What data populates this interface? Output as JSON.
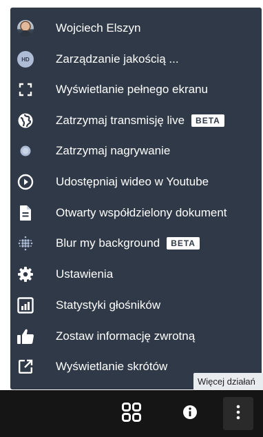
{
  "menu": {
    "items": [
      {
        "label": "Wojciech Elszyn",
        "icon": "avatar"
      },
      {
        "label": "Zarządzanie jakością ...",
        "icon": "hd-icon",
        "icon_text": "HD"
      },
      {
        "label": "Wyświetlanie pełnego ekranu",
        "icon": "fullscreen-icon"
      },
      {
        "label": "Zatrzymaj transmisję live",
        "icon": "live-stream-icon",
        "badge": "BETA"
      },
      {
        "label": "Zatrzymaj nagrywanie",
        "icon": "recording-icon"
      },
      {
        "label": "Udostępniaj wideo w Youtube",
        "icon": "play-circle-icon"
      },
      {
        "label": "Otwarty współdzielony dokument",
        "icon": "document-icon"
      },
      {
        "label": "Blur my background",
        "icon": "blur-icon",
        "badge": "BETA"
      },
      {
        "label": "Ustawienia",
        "icon": "gear-icon"
      },
      {
        "label": "Statystyki głośników",
        "icon": "bar-chart-icon"
      },
      {
        "label": "Zostaw informację zwrotną",
        "icon": "thumbs-up-icon"
      },
      {
        "label": "Wyświetlanie skrótów",
        "icon": "external-link-icon"
      }
    ]
  },
  "tooltip": {
    "text": "Więcej działań"
  },
  "toolbar": {
    "buttons": [
      {
        "icon": "tile-view-icon"
      },
      {
        "icon": "info-icon"
      },
      {
        "icon": "more-vertical-icon"
      }
    ]
  },
  "colors": {
    "menu_background": "#2f3947",
    "bottom_bar": "#151515",
    "text": "#ffffff",
    "tooltip_background": "#e9ecef"
  }
}
